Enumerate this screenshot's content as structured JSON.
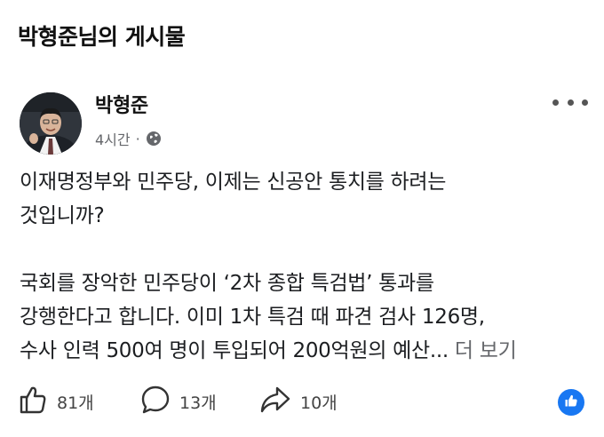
{
  "page": {
    "title": "박형준님의 게시물"
  },
  "post": {
    "author": "박형준",
    "time": "4시간",
    "separator": "·",
    "visibility_icon": "globe-icon",
    "body_lines": [
      "이재명정부와 민주당, 이제는 신공안 통치를 하려는",
      "것입니까?"
    ],
    "body_lines_2": [
      "국회를 장악한 민주당이 ‘2차 종합 특검법’ 통과를",
      "강행한다고 합니다. 이미 1차 특검 때 파견 검사 126명,",
      "수사 인력 500여 명이 투입되어 200억원의 예산..."
    ],
    "see_more": "더 보기"
  },
  "actions": {
    "like_count": "81개",
    "comment_count": "13개",
    "share_count": "10개",
    "like_badge_icon": "thumbs-up-icon"
  },
  "colors": {
    "accent": "#1877f2",
    "muted": "#65676b"
  }
}
